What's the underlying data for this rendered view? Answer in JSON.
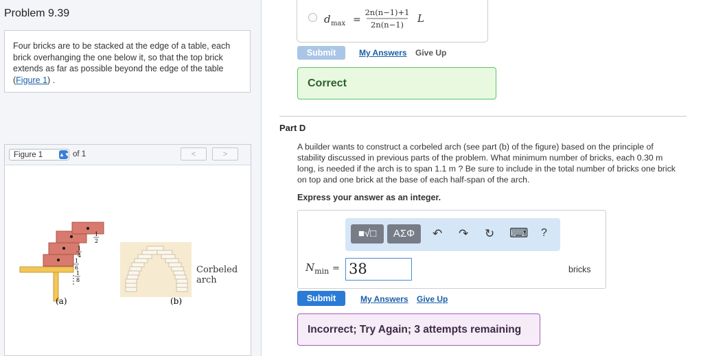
{
  "problem": {
    "title": "Problem 9.39",
    "text": "Four bricks are to be stacked at the edge of a table, each brick overhanging the one below it, so that the top brick extends as far as possible beyond the edge of the table",
    "figure_link": "Figure 1",
    "text_end": "."
  },
  "figure_panel": {
    "select_value": "Figure 1",
    "of_label": "of 1",
    "prev": "<",
    "next": ">",
    "frac_top": "1",
    "frac_half": "2",
    "frac_quarter": "4",
    "frac_sixth": "6",
    "frac_eighth": "8",
    "label_a": "(a)",
    "label_b": "(b)",
    "corbel_line1": "Corbeled",
    "corbel_line2": "arch"
  },
  "prev_part": {
    "formula_var": "d",
    "formula_sub": "max",
    "formula_eq": "=",
    "formula_num": "2n(n−1)+1",
    "formula_den": "2n(n−1)",
    "formula_L": "L",
    "submit": "Submit",
    "my_answers": "My Answers",
    "give_up": "Give Up",
    "feedback": "Correct"
  },
  "part_d": {
    "title": "Part D",
    "text": "A builder wants to construct a corbeled arch (see part (b) of the figure) based on the principle of stability discussed in previous parts of the problem. What minimum number of bricks, each 0.30  m long, is needed if the arch is to span 1.1  m ? Be sure to include in the total number of bricks one brick on top and one brick at the base of each half-span of the arch.",
    "express": "Express your answer as an integer.",
    "toolbar": {
      "templates": "■√□",
      "greek": "AΣΦ",
      "undo": "↶",
      "redo": "↷",
      "reset": "↻",
      "keyboard": "⌨",
      "help": "?"
    },
    "nmin_var": "N",
    "nmin_sub": "min",
    "nmin_eq": "=",
    "answer_value": "38",
    "unit": "bricks",
    "submit": "Submit",
    "my_answers": "My Answers",
    "give_up": "Give Up",
    "feedback": "Incorrect; Try Again; 3 attempts remaining"
  }
}
